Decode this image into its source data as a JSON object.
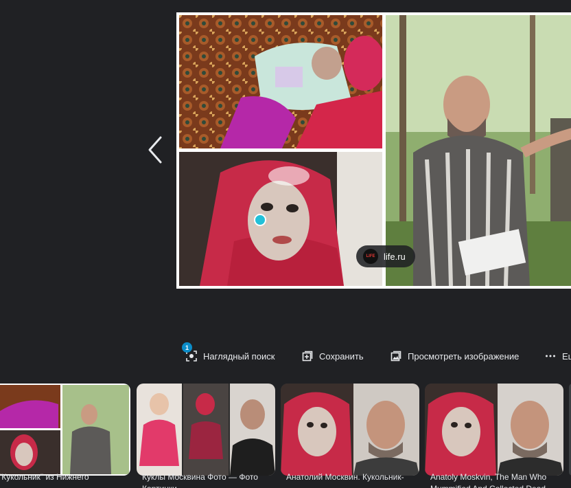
{
  "viewer": {
    "prev_icon": "chevron-left-icon",
    "source": {
      "logo_text": "LIFE",
      "name": "life.ru"
    }
  },
  "actions": [
    {
      "label": "Наглядный поиск",
      "icon": "lens-icon",
      "badge": "1"
    },
    {
      "label": "Сохранить",
      "icon": "bookmark-add-icon"
    },
    {
      "label": "Просмотреть изображение",
      "icon": "image-icon"
    },
    {
      "label": "Ещё",
      "icon": "more-dots-icon"
    }
  ],
  "related": [
    {
      "title": "\"Кукольник\" из Нижнего"
    },
    {
      "title": "Куклы Москвина Фото — Фото Картинки"
    },
    {
      "title": "Анатолий Москвин. Кукольник-"
    },
    {
      "title": "Anatoly Moskvin, The Man Who Mummified And Collected Dead..."
    }
  ],
  "colors": {
    "background": "#202124",
    "marker": "#23c0d8",
    "badge": "#0b8dc9",
    "text": "#e8eaed"
  }
}
